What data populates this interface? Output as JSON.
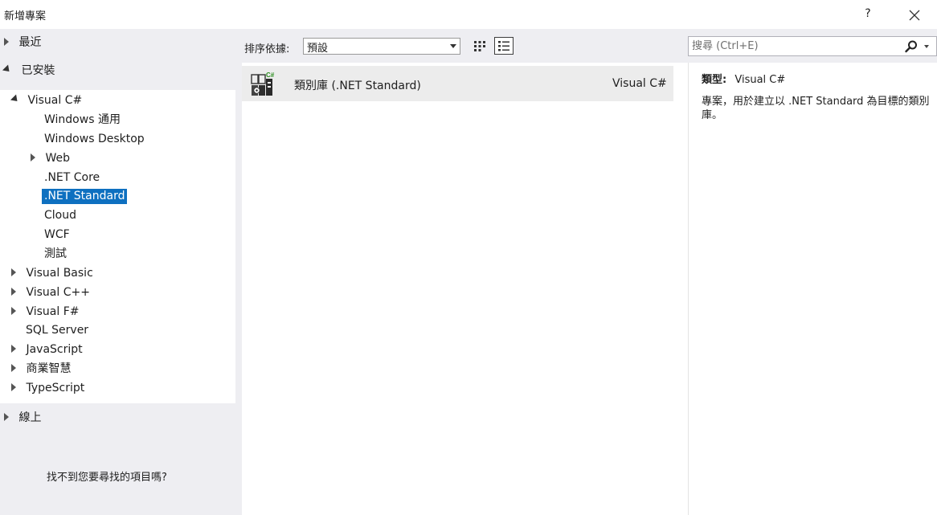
{
  "window": {
    "title": "新增專案",
    "help_label": "?",
    "close_icon": "close-icon"
  },
  "left_nav": {
    "recent": "最近",
    "installed": "已安裝",
    "visual_csharp": "Visual C#",
    "csharp_children": [
      "Windows 通用",
      "Windows Desktop",
      "Web",
      ".NET Core",
      ".NET Standard",
      "Cloud",
      "WCF",
      "測試"
    ],
    "languages": [
      "Visual Basic",
      "Visual C++",
      "Visual F#",
      "SQL Server",
      "JavaScript",
      "商業智慧",
      "TypeScript"
    ],
    "online": "線上",
    "not_found_link": "找不到您要尋找的項目嗎?"
  },
  "toolbar": {
    "sort_label": "排序依據:",
    "sort_value": "預設",
    "small_icons_view": "small-icons-view-icon",
    "list_view": "list-view-icon"
  },
  "templates": [
    {
      "name": "類別庫 (.NET Standard)",
      "language": "Visual C#",
      "icon": "class-library-csharp-icon"
    }
  ],
  "search": {
    "placeholder": "搜尋 (Ctrl+E)"
  },
  "details": {
    "type_label": "類型:",
    "type_value": "Visual C#",
    "description": "專案，用於建立以 .NET Standard 為目標的類別庫。"
  },
  "colors": {
    "selection": "#0e70c0",
    "background": "#eeeef2",
    "row_highlight": "#ececec"
  }
}
